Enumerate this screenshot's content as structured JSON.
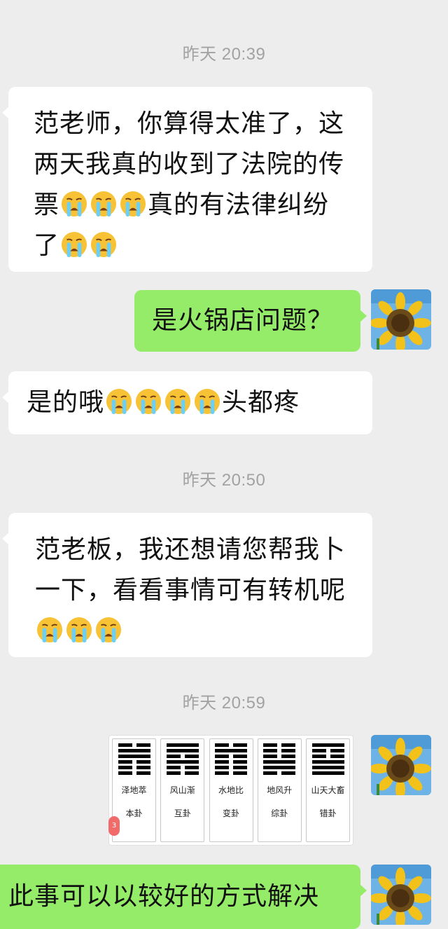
{
  "timestamps": [
    "昨天 20:39",
    "昨天 20:50",
    "昨天 20:59"
  ],
  "messages": {
    "m1": {
      "l1": "范老师，你算得太准了，这",
      "l2": "两天我真的收到了法院的传",
      "l3a": "票",
      "l3b": "真的有法律纠纷",
      "l4": "了"
    },
    "m2": {
      "text": "是火锅店问题？"
    },
    "m3": {
      "a": "是的哦",
      "b": "头都疼"
    },
    "m4": {
      "l1": "范老板，我还想请您帮我卜",
      "l2": "一下，看看事情可有转机呢"
    },
    "m6": {
      "text": "此事可以以较好的方式解决"
    }
  },
  "hexagram_card": {
    "items": [
      {
        "name": "泽地萃",
        "role": "本卦"
      },
      {
        "name": "风山渐",
        "role": "互卦"
      },
      {
        "name": "水地比",
        "role": "变卦"
      },
      {
        "name": "地风升",
        "role": "综卦"
      },
      {
        "name": "山天大畜",
        "role": "错卦"
      }
    ],
    "badge": "3"
  },
  "emoji_name": "loudly-crying-face",
  "colors": {
    "background": "#ededed",
    "incoming": "#ffffff",
    "outgoing": "#95ec69",
    "timestamp": "#a2a2a2"
  }
}
